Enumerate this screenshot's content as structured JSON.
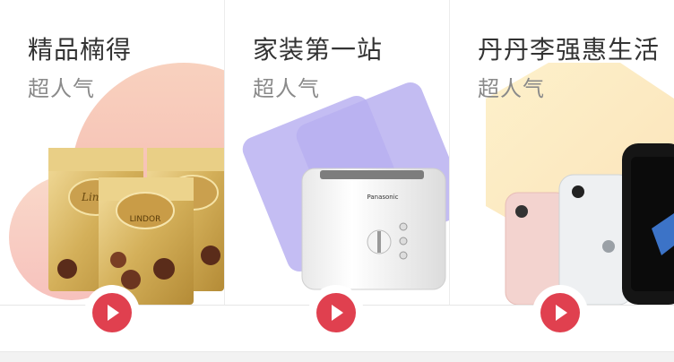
{
  "cards": [
    {
      "title": "精品楠得",
      "subtitle": "超人气",
      "product_icon": "chocolate-box-icon",
      "play_icon": "play-icon"
    },
    {
      "title": "家装第一站",
      "subtitle": "超人气",
      "product_icon": "toaster-icon",
      "play_icon": "play-icon",
      "toaster_brand": "Panasonic"
    },
    {
      "title": "丹丹李强惠生活",
      "subtitle": "超人气",
      "product_icon": "smartphone-icon",
      "play_icon": "play-icon"
    }
  ],
  "colors": {
    "play_button": "#e0404f",
    "card1_blob": "#f6c6b2",
    "card2_shape": "#c9c3f3",
    "card3_shape": "#fbe6bd"
  },
  "chocolate": {
    "brand": "Lindt",
    "product": "LINDOR"
  }
}
